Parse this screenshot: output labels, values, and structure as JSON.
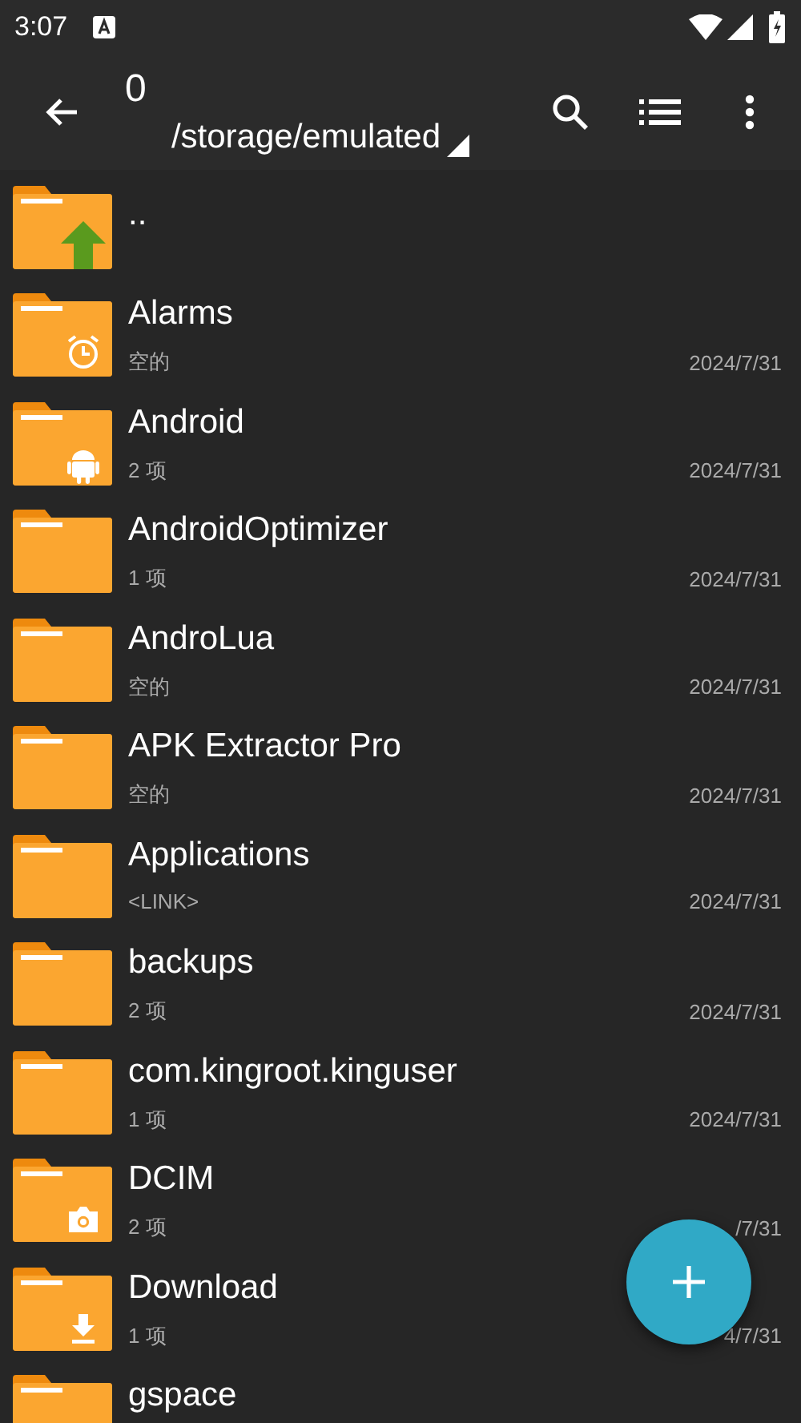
{
  "status_bar": {
    "time": "3:07"
  },
  "toolbar": {
    "title": "0",
    "path": "/storage/emulated"
  },
  "files": [
    {
      "name": "..",
      "kind": "up"
    },
    {
      "name": "Alarms",
      "kind": "alarm",
      "info": "空的",
      "date": "2024/7/31"
    },
    {
      "name": "Android",
      "kind": "android",
      "info": "2 项",
      "date": "2024/7/31"
    },
    {
      "name": "AndroidOptimizer",
      "kind": "plain",
      "info": "1 项",
      "date": "2024/7/31"
    },
    {
      "name": "AndroLua",
      "kind": "plain",
      "info": "空的",
      "date": "2024/7/31"
    },
    {
      "name": "APK Extractor Pro",
      "kind": "plain",
      "info": "空的",
      "date": "2024/7/31"
    },
    {
      "name": "Applications",
      "kind": "plain",
      "info": "<LINK>",
      "date": "2024/7/31"
    },
    {
      "name": "backups",
      "kind": "plain",
      "info": "2 项",
      "date": "2024/7/31"
    },
    {
      "name": "com.kingroot.kinguser",
      "kind": "plain",
      "info": "1 项",
      "date": "2024/7/31"
    },
    {
      "name": "DCIM",
      "kind": "camera",
      "info": "2 项",
      "date": "/7/31"
    },
    {
      "name": "Download",
      "kind": "download",
      "info": "1 项",
      "date": "4/7/31"
    },
    {
      "name": "gspace",
      "kind": "plain"
    }
  ]
}
